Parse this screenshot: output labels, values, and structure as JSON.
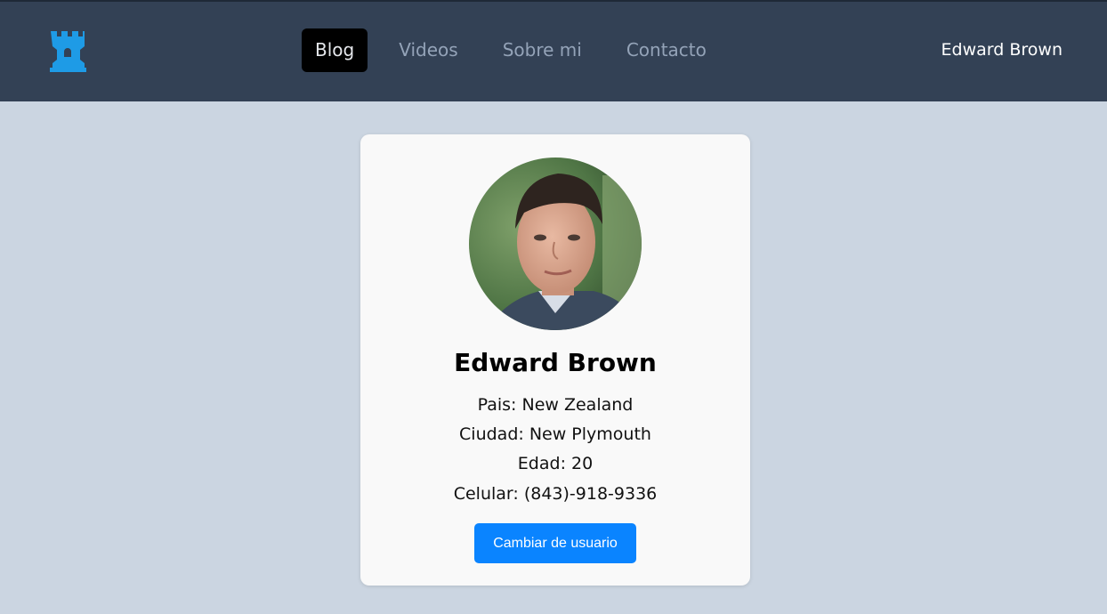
{
  "nav": {
    "logo_icon": "rook-tower-icon",
    "accent_color": "#1e9be6",
    "links": [
      {
        "label": "Blog",
        "active": true
      },
      {
        "label": "Videos",
        "active": false
      },
      {
        "label": "Sobre mi",
        "active": false
      },
      {
        "label": "Contacto",
        "active": false
      }
    ],
    "user_name": "Edward Brown"
  },
  "profile": {
    "name": "Edward Brown",
    "pais": "Pais: New Zealand",
    "ciudad": "Ciudad: New Plymouth",
    "edad": "Edad: 20",
    "celular": "Celular: (843)-918-9336",
    "button_label": "Cambiar de usuario",
    "button_color": "#0a84ff"
  }
}
